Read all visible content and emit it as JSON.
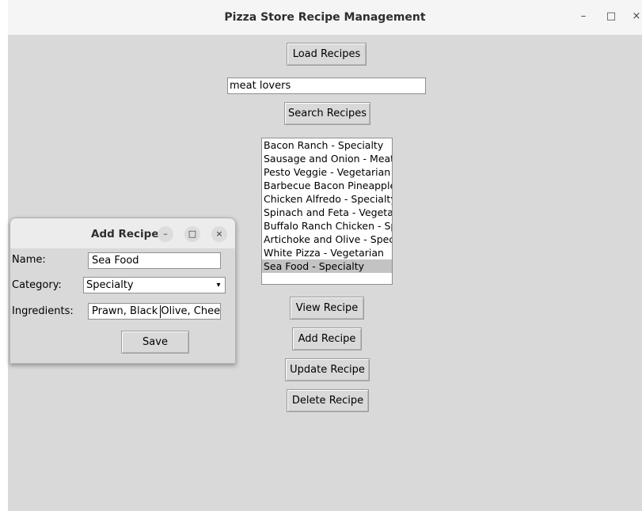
{
  "window": {
    "title": "Pizza Store Recipe Management",
    "minimize": "–",
    "maximize": "□",
    "close": "×"
  },
  "main": {
    "load_label": "Load Recipes",
    "search_value": "meat lovers",
    "search_label": "Search Recipes",
    "recipes": [
      "Bacon Ranch - Specialty",
      "Sausage and Onion - Meat",
      "Pesto Veggie - Vegetarian",
      "Barbecue Bacon Pineapple",
      "Chicken Alfredo - Specialty",
      "Spinach and Feta - Vegetarian",
      "Buffalo Ranch Chicken - Specialty",
      "Artichoke and Olive - Specialty",
      "White Pizza - Vegetarian",
      "Sea Food - Specialty"
    ],
    "selected_index": 9,
    "view_label": "View Recipe",
    "add_label": "Add Recipe",
    "update_label": "Update Recipe",
    "delete_label": "Delete Recipe"
  },
  "dialog": {
    "title": "Add Recipe",
    "minimize": "–",
    "maximize": "□",
    "close": "×",
    "name_label": "Name:",
    "name_value": "Sea Food",
    "category_label": "Category:",
    "category_value": "Specialty",
    "ingredients_label": "Ingredients:",
    "ingredients_value": "Prawn, Black Olive, Chee",
    "save_label": "Save"
  }
}
